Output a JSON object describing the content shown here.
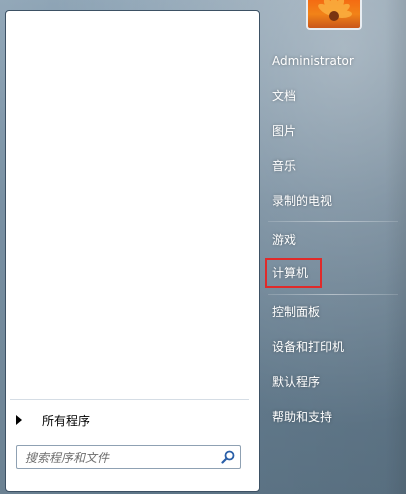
{
  "left_pane": {
    "all_programs_label": "所有程序",
    "search": {
      "placeholder": "搜索程序和文件",
      "value": ""
    }
  },
  "right_pane": {
    "items": [
      {
        "label": "Administrator"
      },
      {
        "label": "文档"
      },
      {
        "label": "图片"
      },
      {
        "label": "音乐"
      },
      {
        "label": "录制的电视"
      },
      {
        "label": "游戏"
      },
      {
        "label": "计算机",
        "highlighted": true
      },
      {
        "label": "控制面板"
      },
      {
        "label": "设备和打印机"
      },
      {
        "label": "默认程序"
      },
      {
        "label": "帮助和支持"
      }
    ]
  },
  "colors": {
    "highlight_border": "#e02a2a",
    "avatar_orange": "#f46b12"
  },
  "icons": {
    "search": "search-icon",
    "all_programs": "triangle-right-icon",
    "avatar": "flower-avatar"
  }
}
